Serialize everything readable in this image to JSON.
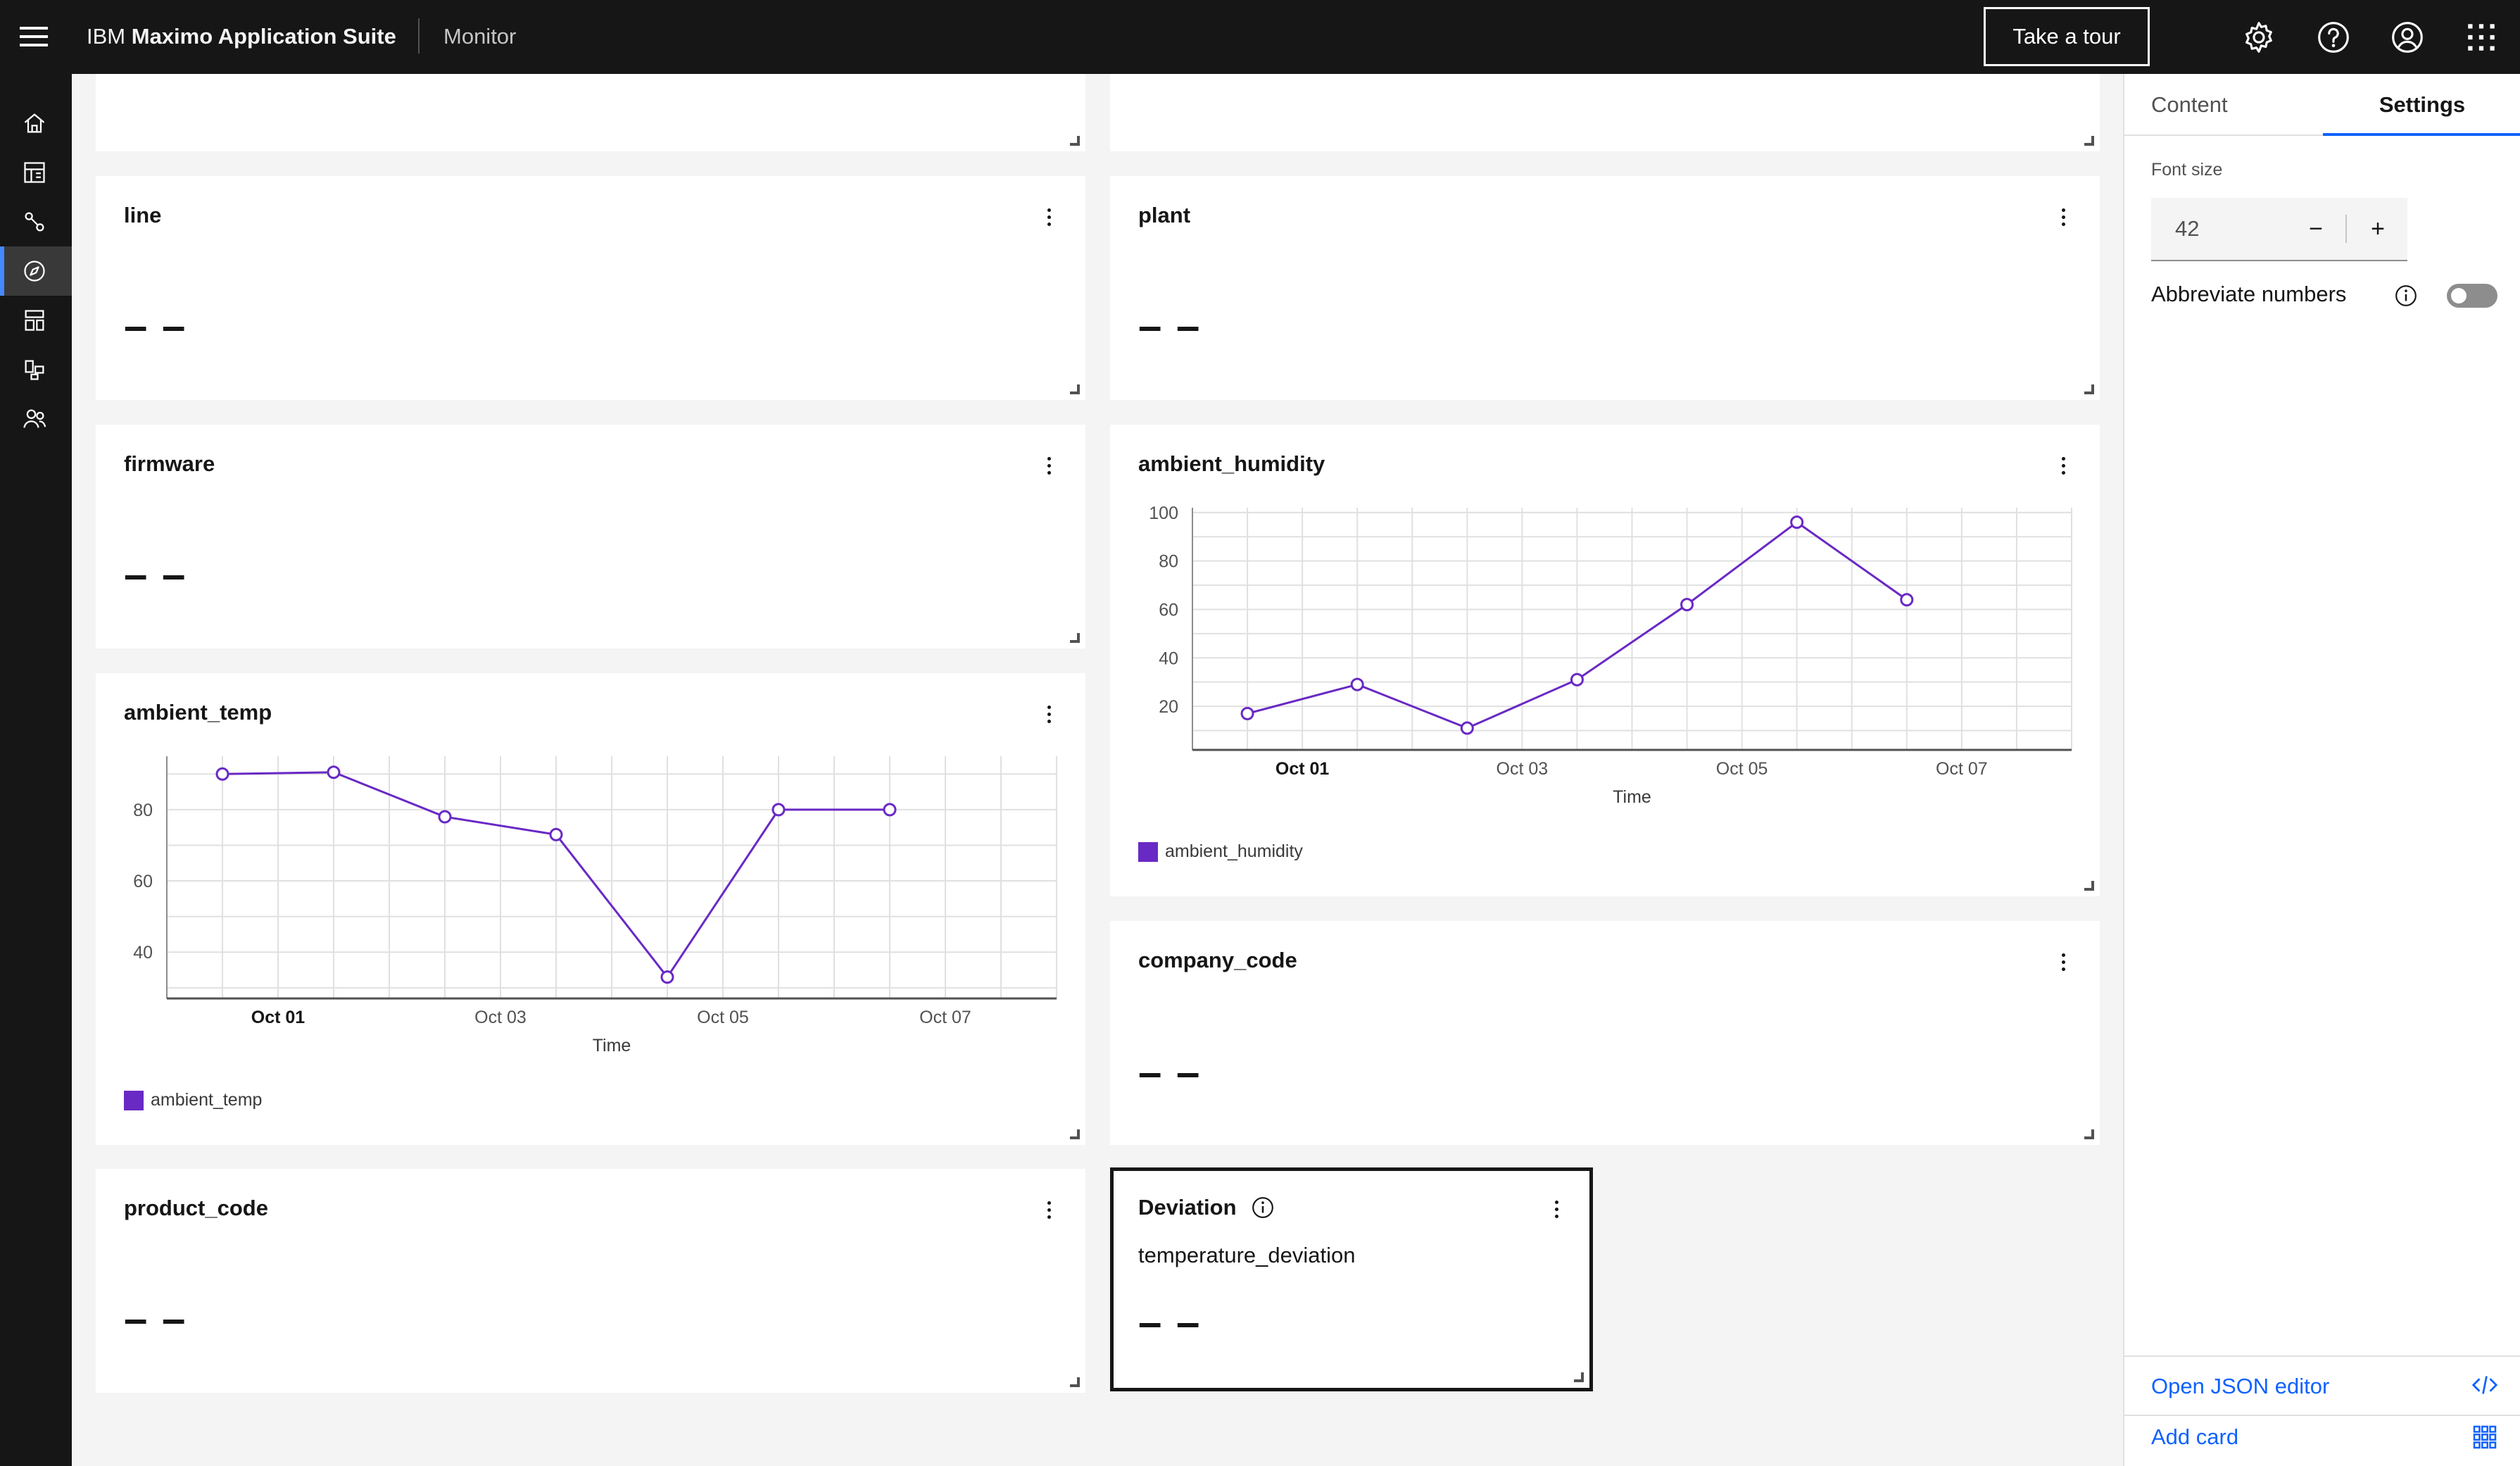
{
  "header": {
    "brand_prefix": "IBM",
    "brand_name": "Maximo Application Suite",
    "app_name": "Monitor",
    "tour_label": "Take a tour",
    "icons": [
      "settings-icon",
      "help-icon",
      "user-icon",
      "app-switcher-icon"
    ]
  },
  "rail": {
    "items": [
      "home-icon",
      "dashboard-icon",
      "connections-icon",
      "monitor-icon",
      "setup-icon",
      "devices-icon",
      "users-icon"
    ],
    "active": "monitor-icon"
  },
  "cards": {
    "top_left": {
      "value": "– –"
    },
    "top_right": {
      "value": "– –"
    },
    "line": {
      "title": "line",
      "value": "– –"
    },
    "plant": {
      "title": "plant",
      "value": "– –"
    },
    "firmware": {
      "title": "firmware",
      "value": "– –"
    },
    "ambient_humidity": {
      "title": "ambient_humidity",
      "legend": "ambient_humidity"
    },
    "ambient_temp": {
      "title": "ambient_temp",
      "legend": "ambient_temp"
    },
    "company_code": {
      "title": "company_code",
      "value": "– –"
    },
    "product_code": {
      "title": "product_code",
      "value": "– –"
    },
    "deviation": {
      "title": "Deviation",
      "subtitle": "temperature_deviation",
      "value": "– –"
    }
  },
  "chart_data": [
    {
      "type": "line",
      "title": "ambient_humidity",
      "xlabel": "Time",
      "ylabel": "",
      "x_ticks": [
        "Oct 01",
        "Oct 03",
        "Oct 05",
        "Oct 07"
      ],
      "x": [
        "Sep 30 12:00",
        "Oct 01 12:00",
        "Oct 02 12:00",
        "Oct 03 12:00",
        "Oct 04 12:00",
        "Oct 05 12:00",
        "Oct 06 12:00"
      ],
      "y_ticks": [
        20,
        40,
        60,
        80,
        100
      ],
      "ylim": [
        2,
        102
      ],
      "grid": true,
      "legend": "bottom-left",
      "series": [
        {
          "name": "ambient_humidity",
          "values": [
            17,
            29,
            11,
            31,
            62,
            96,
            64
          ]
        }
      ],
      "color": "#6929c4"
    },
    {
      "type": "line",
      "title": "ambient_temp",
      "xlabel": "Time",
      "ylabel": "",
      "x_ticks": [
        "Oct 01",
        "Oct 03",
        "Oct 05",
        "Oct 07"
      ],
      "x": [
        "Sep 30 12:00",
        "Oct 01 12:00",
        "Oct 02 12:00",
        "Oct 03 12:00",
        "Oct 04 12:00",
        "Oct 05 12:00",
        "Oct 06 12:00"
      ],
      "y_ticks": [
        40,
        60,
        80
      ],
      "ylim": [
        27,
        95
      ],
      "grid": true,
      "legend": "bottom-left",
      "series": [
        {
          "name": "ambient_temp",
          "values": [
            90,
            90.5,
            78,
            73,
            33,
            80,
            80
          ]
        }
      ],
      "color": "#6929c4"
    }
  ],
  "panel": {
    "tabs": [
      "Content",
      "Settings"
    ],
    "active_tab": "Settings",
    "font_size_label": "Font size",
    "font_size_value": "42",
    "minus": "−",
    "plus": "+",
    "abbreviate_label": "Abbreviate numbers",
    "abbreviate_on": false,
    "json_editor_label": "Open JSON editor",
    "add_card_label": "Add card"
  },
  "colors": {
    "accent": "#0f62fe",
    "series": "#6929c4",
    "header_bg": "#161616"
  }
}
